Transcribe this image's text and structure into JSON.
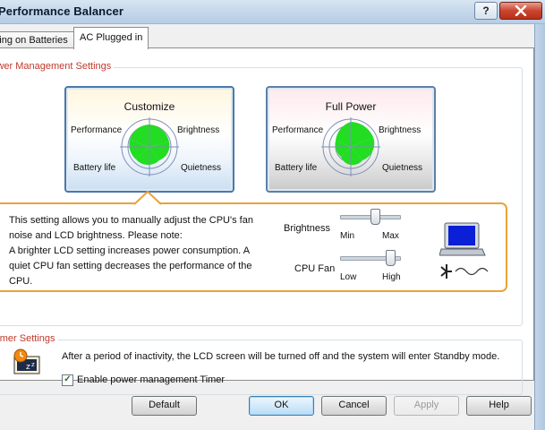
{
  "window": {
    "title": "Performance Balancer",
    "help_glyph": "?",
    "close_glyph": "X"
  },
  "tabs": [
    {
      "label": "Running on Batteries"
    },
    {
      "label": "AC Plugged in"
    }
  ],
  "power_management": {
    "group_label": "Power Management Settings",
    "modes": [
      {
        "title": "Customize",
        "labels": {
          "performance": "Performance",
          "brightness": "Brightness",
          "battery_life": "Battery life",
          "quietness": "Quietness"
        }
      },
      {
        "title": "Full Power",
        "labels": {
          "performance": "Performance",
          "brightness": "Brightness",
          "battery_life": "Battery life",
          "quietness": "Quietness"
        }
      }
    ],
    "selected_mode": "Customize",
    "description": "This setting allows you to manually adjust the CPU's fan noise and LCD brightness. Please note:\nA brighter LCD setting increases power consumption. A quiet CPU fan setting decreases the performance of the CPU.",
    "brightness": {
      "label": "Brightness",
      "min_label": "Min",
      "max_label": "Max",
      "level": 0.6
    },
    "cpu_fan": {
      "label": "CPU Fan",
      "min_label": "Low",
      "max_label": "High",
      "level": 0.9
    }
  },
  "timer": {
    "group_label": "Timer Settings",
    "message": "After a period of inactivity, the LCD screen will be turned off and the system will enter Standby mode.",
    "checkbox_label": "Enable power management Timer",
    "checked": true
  },
  "buttons": {
    "default": "Default",
    "ok": "OK",
    "cancel": "Cancel",
    "apply": "Apply",
    "help": "Help"
  },
  "colors": {
    "accent_orange": "#e8a33a",
    "radar_green": "#22dd22",
    "group_label_red": "#c0392b",
    "lcd_blue": "#0a1fd6"
  }
}
